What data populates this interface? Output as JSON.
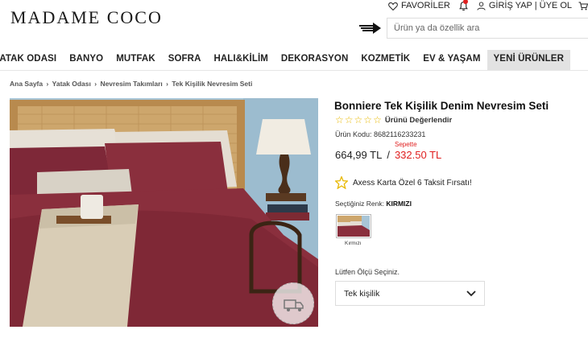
{
  "header": {
    "logo": "MADAME COCO",
    "favorites_label": "FAVORİLER",
    "login_label": "GİRİŞ YAP | ÜYE OL",
    "search_placeholder": "Ürün ya da özellik ara"
  },
  "nav": {
    "items": [
      "YATAK ODASI",
      "BANYO",
      "MUTFAK",
      "SOFRA",
      "HALI&KİLİM",
      "DEKORASYON",
      "KOZMETİK",
      "EV & YAŞAM",
      "YENİ ÜRÜNLER"
    ]
  },
  "breadcrumb": [
    "Ana Sayfa",
    "Yatak Odası",
    "Nevresim Takımları",
    "Tek Kişilik Nevresim Seti"
  ],
  "product": {
    "title": "Bonniere Tek Kişilik Denim Nevresim Seti",
    "rating_label": "Ürünü Değerlendir",
    "rating_stars": 0,
    "sku": "Ürün Kodu: 8682116233231",
    "basket_label": "Sepette",
    "price_old": "664,99 TL",
    "price_separator": "/",
    "price_new": "332.50 TL",
    "installment": "Axess Karta Özel 6 Taksit Fırsatı!",
    "color_prefix": "Seçtiğiniz Renk: ",
    "color_value": "KIRMIZI",
    "swatch_caption": "Kırmızı",
    "size_label": "Lütfen Ölçü Seçiniz.",
    "size_value": "Tek kişilik",
    "image_badge": "KARGO BEDAVA"
  },
  "colors": {
    "accent_red": "#e02020",
    "star": "#e8b800",
    "duvet": "#8a2f3d"
  }
}
